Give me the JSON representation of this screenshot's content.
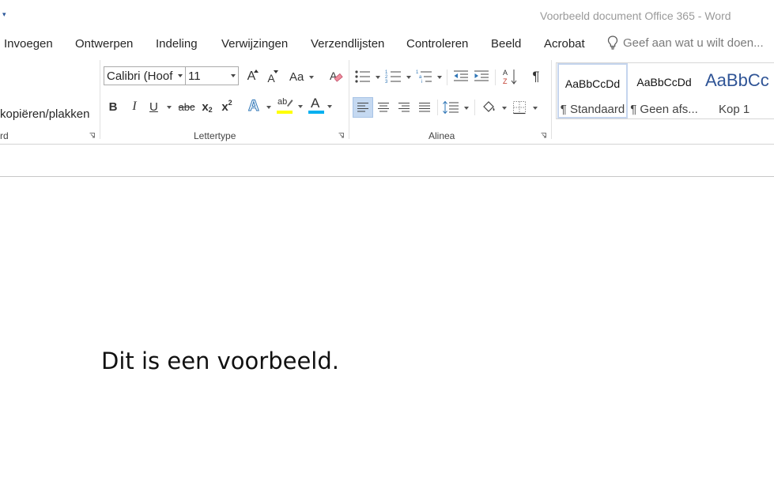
{
  "window": {
    "title": "Voorbeeld document Office 365 - Word"
  },
  "qat": {
    "customize_symbol": "▾"
  },
  "tabs": [
    {
      "label": "Invoegen"
    },
    {
      "label": "Ontwerpen"
    },
    {
      "label": "Indeling"
    },
    {
      "label": "Verwijzingen"
    },
    {
      "label": "Verzendlijsten"
    },
    {
      "label": "Controleren"
    },
    {
      "label": "Beeld"
    },
    {
      "label": "Acrobat"
    }
  ],
  "tellme": {
    "text": "Geef aan wat u wilt doen...",
    "icon": "lightbulb-icon"
  },
  "clipboard": {
    "format_painter_label": "kopiëren/plakken",
    "group_label_fragment": "rd"
  },
  "font": {
    "group_label": "Lettertype",
    "font_name": "Calibri (Hoof",
    "font_size": "11",
    "grow_label": "A",
    "shrink_label": "A",
    "case_label": "Aa",
    "bold": "B",
    "italic": "I",
    "underline": "U",
    "strike": "abc",
    "subscript_base": "x",
    "subscript_mark": "2",
    "superscript_base": "x",
    "superscript_mark": "2",
    "effects_label": "A",
    "highlight_label": "ab",
    "fontcolor_label": "A",
    "highlight_color": "#ffff00",
    "fontcolor_color": "#00b0f0"
  },
  "paragraph": {
    "group_label": "Alinea",
    "pilcrow": "¶"
  },
  "styles": {
    "items": [
      {
        "sample": "AaBbCcDd",
        "name": "¶ Standaard"
      },
      {
        "sample": "AaBbCcDd",
        "name": "¶ Geen afs..."
      },
      {
        "sample": "AaBbCc",
        "name": "Kop 1"
      }
    ]
  },
  "document": {
    "text": "Dit is een voorbeeld."
  },
  "colors": {
    "accent": "#2b579a",
    "heading": "#2f5496"
  }
}
